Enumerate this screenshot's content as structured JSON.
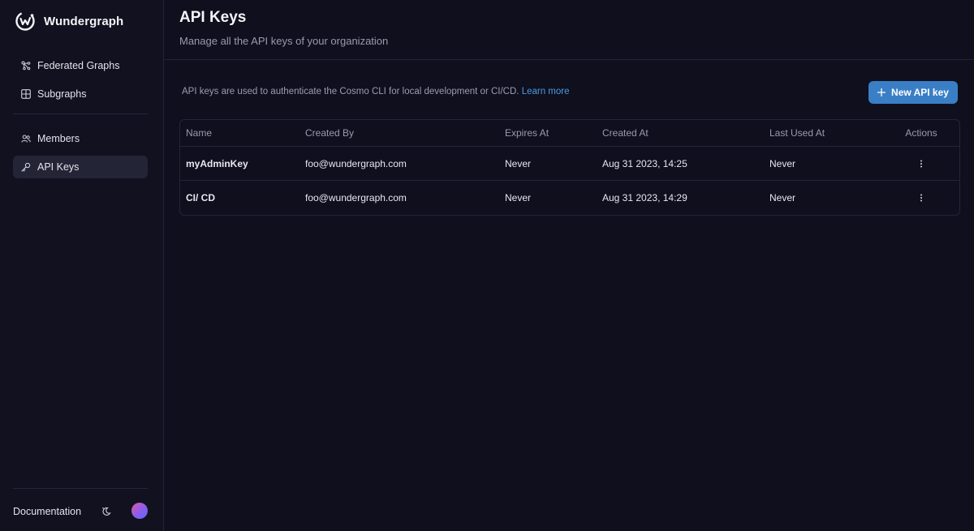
{
  "brand": {
    "name": "Wundergraph"
  },
  "sidebar": {
    "items": [
      {
        "label": "Federated Graphs",
        "icon": "graph-icon"
      },
      {
        "label": "Subgraphs",
        "icon": "grid-icon"
      },
      {
        "label": "Members",
        "icon": "users-icon"
      },
      {
        "label": "API Keys",
        "icon": "key-icon",
        "active": true
      }
    ],
    "footer": {
      "documentation": "Documentation"
    }
  },
  "header": {
    "title": "API Keys",
    "subtitle": "Manage all the API keys of your organization"
  },
  "info": {
    "text": "API keys are used to authenticate the Cosmo CLI for local development or CI/CD.",
    "link": "Learn more"
  },
  "actions": {
    "new_key": "New API key"
  },
  "table": {
    "columns": [
      "Name",
      "Created By",
      "Expires At",
      "Created At",
      "Last Used At",
      "Actions"
    ],
    "rows": [
      {
        "name": "myAdminKey",
        "created_by": "foo@wundergraph.com",
        "expires_at": "Never",
        "created_at": "Aug 31 2023, 14:25",
        "last_used_at": "Never"
      },
      {
        "name": "CI/ CD",
        "created_by": "foo@wundergraph.com",
        "expires_at": "Never",
        "created_at": "Aug 31 2023, 14:29",
        "last_used_at": "Never"
      }
    ]
  },
  "colors": {
    "background": "#0f0f1e",
    "accent": "#3a7fc6",
    "link": "#4d9be0"
  }
}
